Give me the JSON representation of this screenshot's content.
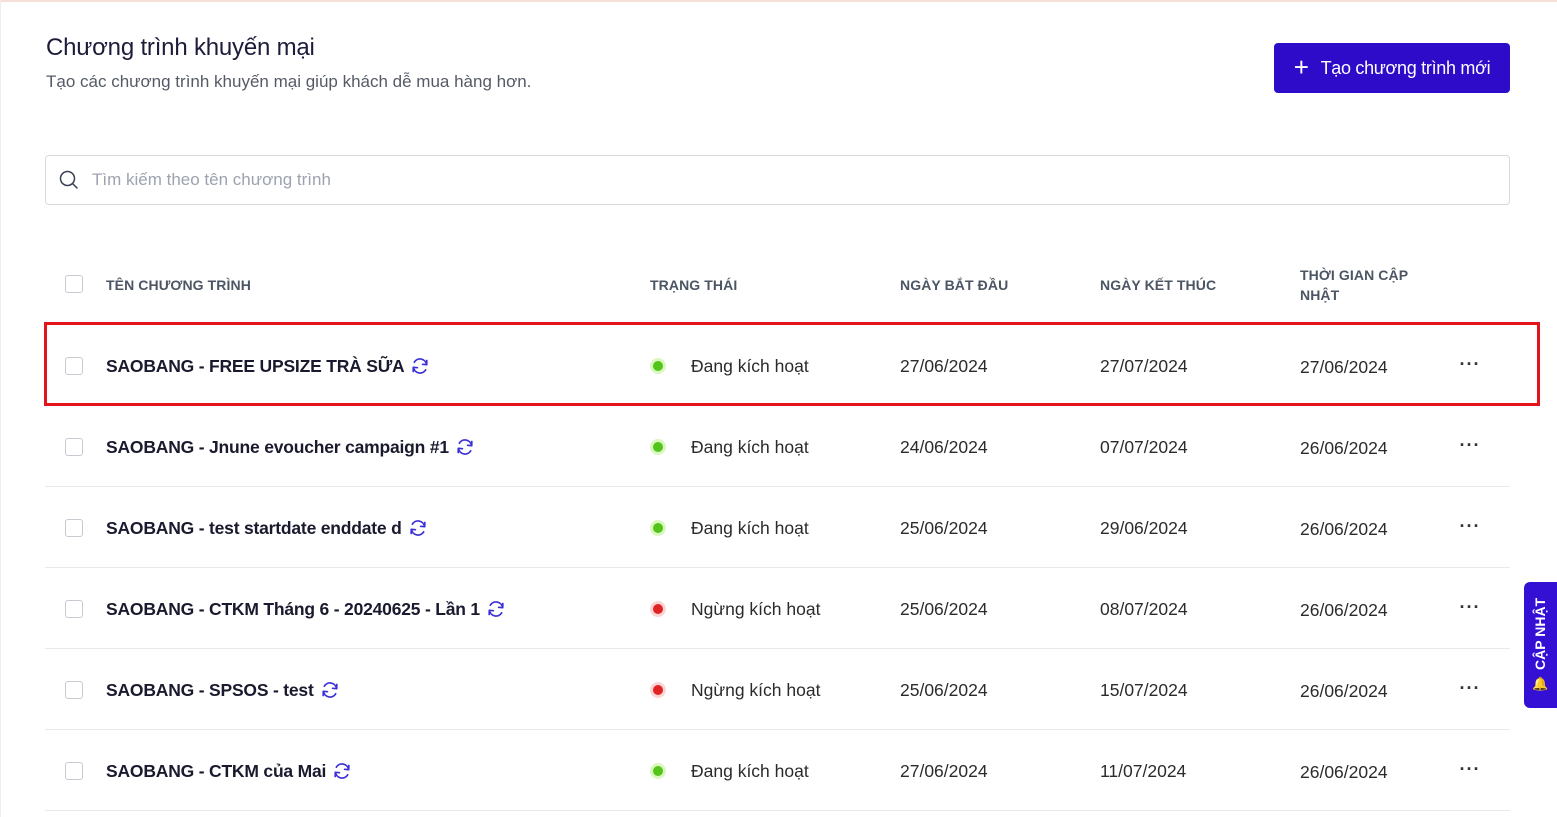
{
  "page": {
    "title": "Chương trình khuyến mại",
    "subtitle": "Tạo các chương trình khuyến mại giúp khách dễ mua hàng hơn.",
    "create_button_label": "Tạo chương trình mới"
  },
  "search": {
    "placeholder": "Tìm kiếm theo tên chương trình",
    "value": ""
  },
  "table": {
    "headers": {
      "name": "TÊN CHƯƠNG TRÌNH",
      "status": "TRẠNG THÁI",
      "start": "NGÀY BẮT ĐẦU",
      "end": "NGÀY KẾT THÚC",
      "updated_line1": "THỜI GIAN CẬP",
      "updated_line2": "NHẬT"
    },
    "rows": [
      {
        "name": "SAOBANG - FREE UPSIZE TRÀ SỮA",
        "status": "Đang kích hoạt",
        "status_color": "#52c41a",
        "status_ring": "#d9f7be",
        "start": "27/06/2024",
        "end": "27/07/2024",
        "updated": "27/06/2024"
      },
      {
        "name": "SAOBANG - Jnune evoucher campaign #1",
        "status": "Đang kích hoạt",
        "status_color": "#52c41a",
        "status_ring": "#d9f7be",
        "start": "24/06/2024",
        "end": "07/07/2024",
        "updated": "26/06/2024"
      },
      {
        "name": "SAOBANG - test startdate enddate d",
        "status": "Đang kích hoạt",
        "status_color": "#52c41a",
        "status_ring": "#d9f7be",
        "start": "25/06/2024",
        "end": "29/06/2024",
        "updated": "26/06/2024"
      },
      {
        "name": "SAOBANG - CTKM Tháng 6 - 20240625 - Lần 1",
        "status": "Ngừng kích hoạt",
        "status_color": "#e02424",
        "status_ring": "#fbd5d5",
        "start": "25/06/2024",
        "end": "08/07/2024",
        "updated": "26/06/2024"
      },
      {
        "name": "SAOBANG - SPSOS - test",
        "status": "Ngừng kích hoạt",
        "status_color": "#e02424",
        "status_ring": "#fbd5d5",
        "start": "25/06/2024",
        "end": "15/07/2024",
        "updated": "26/06/2024"
      },
      {
        "name": "SAOBANG - CTKM của Mai",
        "status": "Đang kích hoạt",
        "status_color": "#52c41a",
        "status_ring": "#d9f7be",
        "start": "27/06/2024",
        "end": "11/07/2024",
        "updated": "26/06/2024"
      }
    ],
    "more_label": "···"
  },
  "side_tab": {
    "label": "CẬP NHẬT",
    "icon": "bell-icon"
  },
  "colors": {
    "primary": "#2d0bc9",
    "highlight": "#e3141b",
    "sync_icon": "#3b2fd6"
  }
}
